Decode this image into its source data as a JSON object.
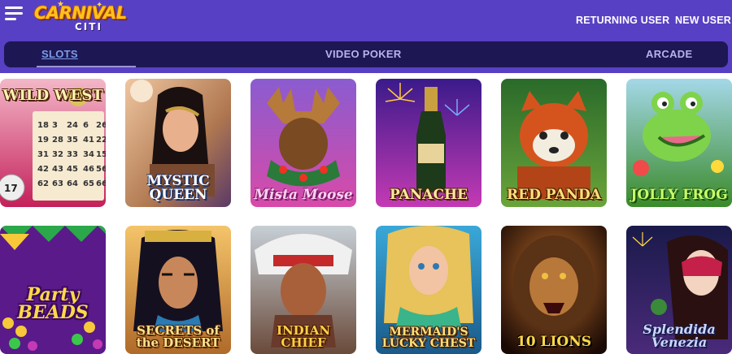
{
  "brand": {
    "name_top": "CARNIVAL",
    "name_bottom": "CITI"
  },
  "header": {
    "returning_user": "RETURNING USER",
    "new_user": "NEW USER"
  },
  "nav": {
    "tabs": [
      {
        "label": "SLOTS",
        "active": true
      },
      {
        "label": "VIDEO POKER",
        "active": false
      },
      {
        "label": "ARCADE",
        "active": false
      }
    ]
  },
  "games": [
    {
      "title": "WILD WEST"
    },
    {
      "title": "MYSTIC QUEEN"
    },
    {
      "title": "Mista Moose"
    },
    {
      "title": "PANACHE"
    },
    {
      "title": "RED PANDA"
    },
    {
      "title": "JOLLY FROG"
    },
    {
      "title": "Party BEADS"
    },
    {
      "title": "SECRETS of the DESERT"
    },
    {
      "title": "INDIAN CHIEF"
    },
    {
      "title": "MERMAID'S LUCKY CHEST"
    },
    {
      "title": "10 LIONS"
    },
    {
      "title": "Splendida Venezia"
    }
  ],
  "colors": {
    "header_bg": "#5840c4",
    "nav_bg": "#1d1754",
    "logo_gold": "#ffc21a"
  }
}
